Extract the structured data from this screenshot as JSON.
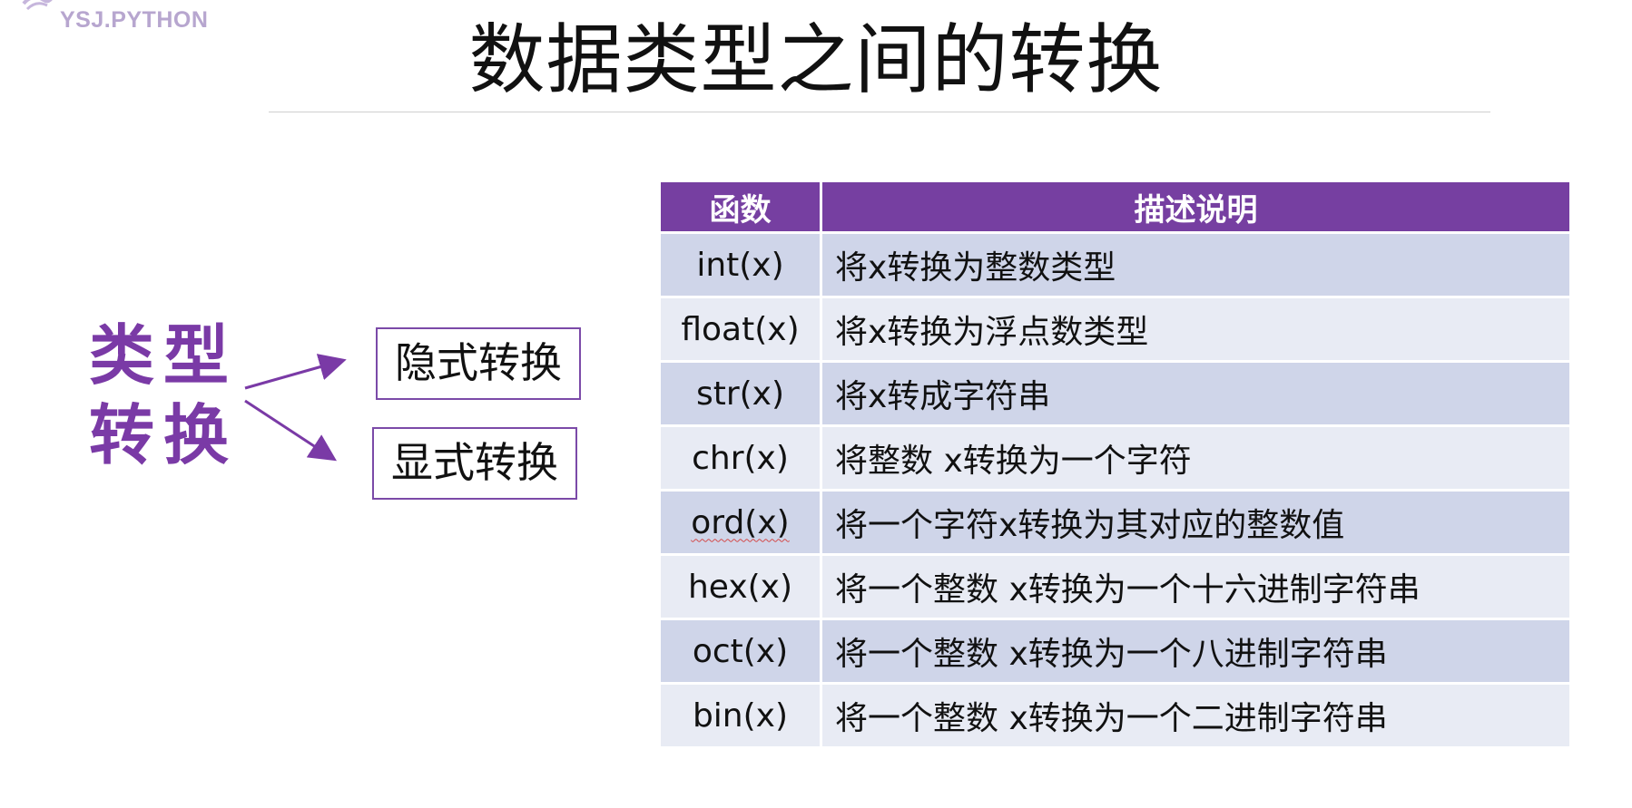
{
  "logo": {
    "text": "YSJ.PYTHON",
    "icon": "logo-mark-icon",
    "color": "#b7a6cf"
  },
  "title": "数据类型之间的转换",
  "diagram": {
    "category_label": "类型转换",
    "branches": [
      "隐式转换",
      "显式转换"
    ],
    "accent_color": "#7a3aa6"
  },
  "table": {
    "header_color": "#763fa1",
    "row_colors": [
      "#cfd5e9",
      "#e8ebf4"
    ],
    "columns": [
      "函数",
      "描述说明"
    ],
    "rows": [
      {
        "func": "int(x)",
        "desc": "将x转换为整数类型"
      },
      {
        "func": "float(x)",
        "desc": "将x转换为浮点数类型"
      },
      {
        "func": "str(x)",
        "desc": "将x转成字符串"
      },
      {
        "func": "chr(x)",
        "desc": "将整数 x转换为一个字符"
      },
      {
        "func": "ord(x)",
        "desc": "将一个字符x转换为其对应的整数值"
      },
      {
        "func": "hex(x)",
        "desc": "将一个整数 x转换为一个十六进制字符串"
      },
      {
        "func": "oct(x)",
        "desc": "将一个整数 x转换为一个八进制字符串"
      },
      {
        "func": "bin(x)",
        "desc": "将一个整数 x转换为一个二进制字符串"
      }
    ]
  }
}
